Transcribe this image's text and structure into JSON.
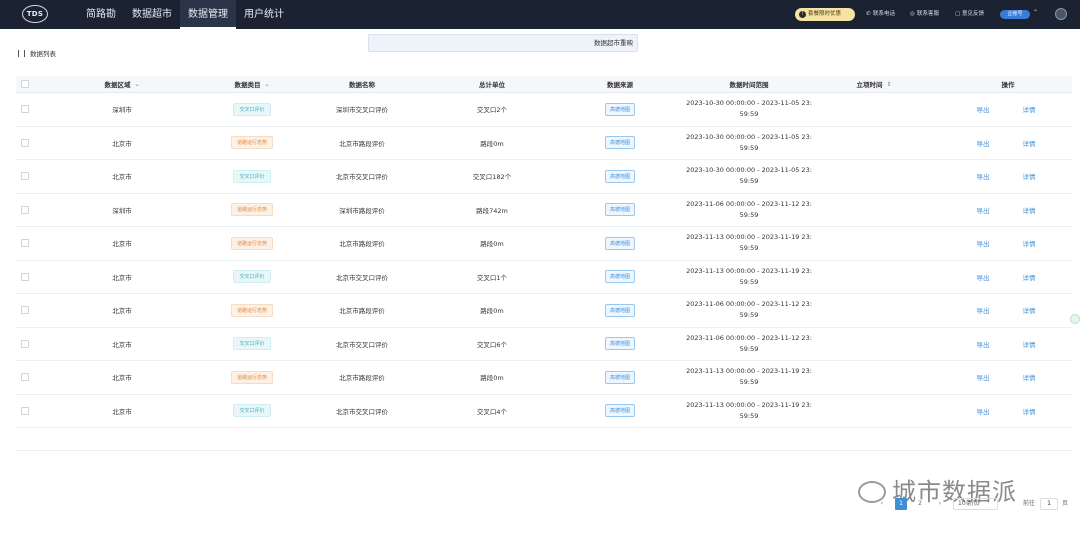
{
  "header": {
    "logo": "TDS",
    "nav": [
      {
        "label": "简路勘",
        "active": false
      },
      {
        "label": "数据超市",
        "active": false
      },
      {
        "label": "数据管理",
        "active": true
      },
      {
        "label": "用户统计",
        "active": false
      }
    ],
    "notice": "套餐限时优惠",
    "links": [
      {
        "icon": "phone-icon",
        "label": "联系电话"
      },
      {
        "icon": "customer-service-icon",
        "label": "联系客服"
      },
      {
        "icon": "feedback-icon",
        "label": "意见反馈"
      }
    ],
    "user_badge": "企账号"
  },
  "subheader": {
    "list_label": "数据列表",
    "super_button": "数据超市重映"
  },
  "table": {
    "columns": [
      "数据区域",
      "数据类目",
      "数据名称",
      "总计单位",
      "数据来源",
      "数据时间范围",
      "立项时间",
      "操作"
    ],
    "actions": {
      "export": "导出",
      "detail": "详情"
    },
    "rows": [
      {
        "region": "深圳市",
        "category": "交叉口评价",
        "cat_color": "blue",
        "name": "深圳市交叉口评价",
        "unit": "交叉口2个",
        "source": "高德地图",
        "time1": "2023-10-30 00:00:00 - 2023-11-05 23:",
        "time2": "59:59"
      },
      {
        "region": "北京市",
        "category": "道路运行态势",
        "cat_color": "orange",
        "name": "北京市路段评价",
        "unit": "路段0m",
        "source": "高德地图",
        "time1": "2023-10-30 00:00:00 - 2023-11-05 23:",
        "time2": "59:59"
      },
      {
        "region": "北京市",
        "category": "交叉口评价",
        "cat_color": "blue",
        "name": "北京市交叉口评价",
        "unit": "交叉口182个",
        "source": "高德地图",
        "time1": "2023-10-30 00:00:00 - 2023-11-05 23:",
        "time2": "59:59"
      },
      {
        "region": "深圳市",
        "category": "道路运行态势",
        "cat_color": "orange",
        "name": "深圳市路段评价",
        "unit": "路段742m",
        "source": "高德地图",
        "time1": "2023-11-06 00:00:00 - 2023-11-12 23:",
        "time2": "59:59"
      },
      {
        "region": "北京市",
        "category": "道路运行态势",
        "cat_color": "orange",
        "name": "北京市路段评价",
        "unit": "路段0m",
        "source": "高德地图",
        "time1": "2023-11-13 00:00:00 - 2023-11-19 23:",
        "time2": "59:59"
      },
      {
        "region": "北京市",
        "category": "交叉口评价",
        "cat_color": "blue",
        "name": "北京市交叉口评价",
        "unit": "交叉口1个",
        "source": "高德地图",
        "time1": "2023-11-13 00:00:00 - 2023-11-19 23:",
        "time2": "59:59"
      },
      {
        "region": "北京市",
        "category": "道路运行态势",
        "cat_color": "orange",
        "name": "北京市路段评价",
        "unit": "路段0m",
        "source": "高德地图",
        "time1": "2023-11-06 00:00:00 - 2023-11-12 23:",
        "time2": "59:59"
      },
      {
        "region": "北京市",
        "category": "交叉口评价",
        "cat_color": "blue",
        "name": "北京市交叉口评价",
        "unit": "交叉口6个",
        "source": "高德地图",
        "time1": "2023-11-06 00:00:00 - 2023-11-12 23:",
        "time2": "59:59"
      },
      {
        "region": "北京市",
        "category": "道路运行态势",
        "cat_color": "orange",
        "name": "北京市路段评价",
        "unit": "路段0m",
        "source": "高德地图",
        "time1": "2023-11-13 00:00:00 - 2023-11-19 23:",
        "time2": "59:59"
      },
      {
        "region": "北京市",
        "category": "交叉口评价",
        "cat_color": "blue",
        "name": "北京市交叉口评价",
        "unit": "交叉口4个",
        "source": "高德地图",
        "time1": "2023-11-13 00:00:00 - 2023-11-19 23:",
        "time2": "59:59"
      }
    ]
  },
  "pagination": {
    "prev": "‹",
    "pages": [
      "1",
      "2"
    ],
    "current": "1",
    "next": "›",
    "page_size": "10条/页",
    "goto_label": "前往",
    "goto_value": "1",
    "page_suffix": "页"
  },
  "watermark": "城市数据派",
  "colors": {
    "topbar": "#1b2232",
    "accent": "#3e8fd8",
    "blue_tag": "#3fb0c2",
    "orange_tag": "#e58a3a"
  }
}
